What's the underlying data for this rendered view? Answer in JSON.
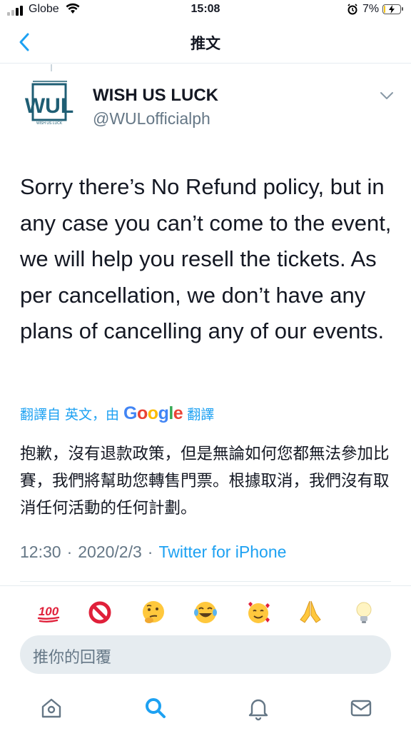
{
  "status_bar": {
    "carrier": "Globe",
    "time": "15:08",
    "battery_pct": "7%",
    "battery_level": 0.07
  },
  "nav": {
    "title": "推文",
    "back_icon": "chevron-left-icon"
  },
  "tweet": {
    "author_name": "WISH US LUCK",
    "author_handle": "@WULofficialph",
    "avatar_text": "WUL",
    "avatar_subtext": "WISH US LUCK",
    "text": "Sorry there’s No Refund policy, but in any case you can’t come to the event, we will help you resell the tickets. As per cancellation, we don’t have any plans of cancelling any of our events.",
    "translate": {
      "prefix": "翻譯自 英文，由",
      "brand": "Google",
      "suffix": "翻譯"
    },
    "translated_text": "抱歉，沒有退款政策，但是無論如何您都無法參加比賽，我們將幫助您轉售門票。根據取消，我們沒有取消任何活動的任何計劃。",
    "time": "12:30",
    "date": "2020/2/3",
    "separator": "·",
    "source": "Twitter for iPhone"
  },
  "quick_reactions": [
    "💯",
    "🚫",
    "🤔",
    "😂",
    "🥰",
    "🙏",
    "💡"
  ],
  "reply": {
    "placeholder": "推你的回覆"
  },
  "tabbar": {
    "items": [
      "home-icon",
      "search-icon",
      "notifications-icon",
      "messages-icon"
    ]
  },
  "colors": {
    "accent": "#1da1f2",
    "secondary_text": "#657786",
    "divider": "#e6ecf0"
  }
}
